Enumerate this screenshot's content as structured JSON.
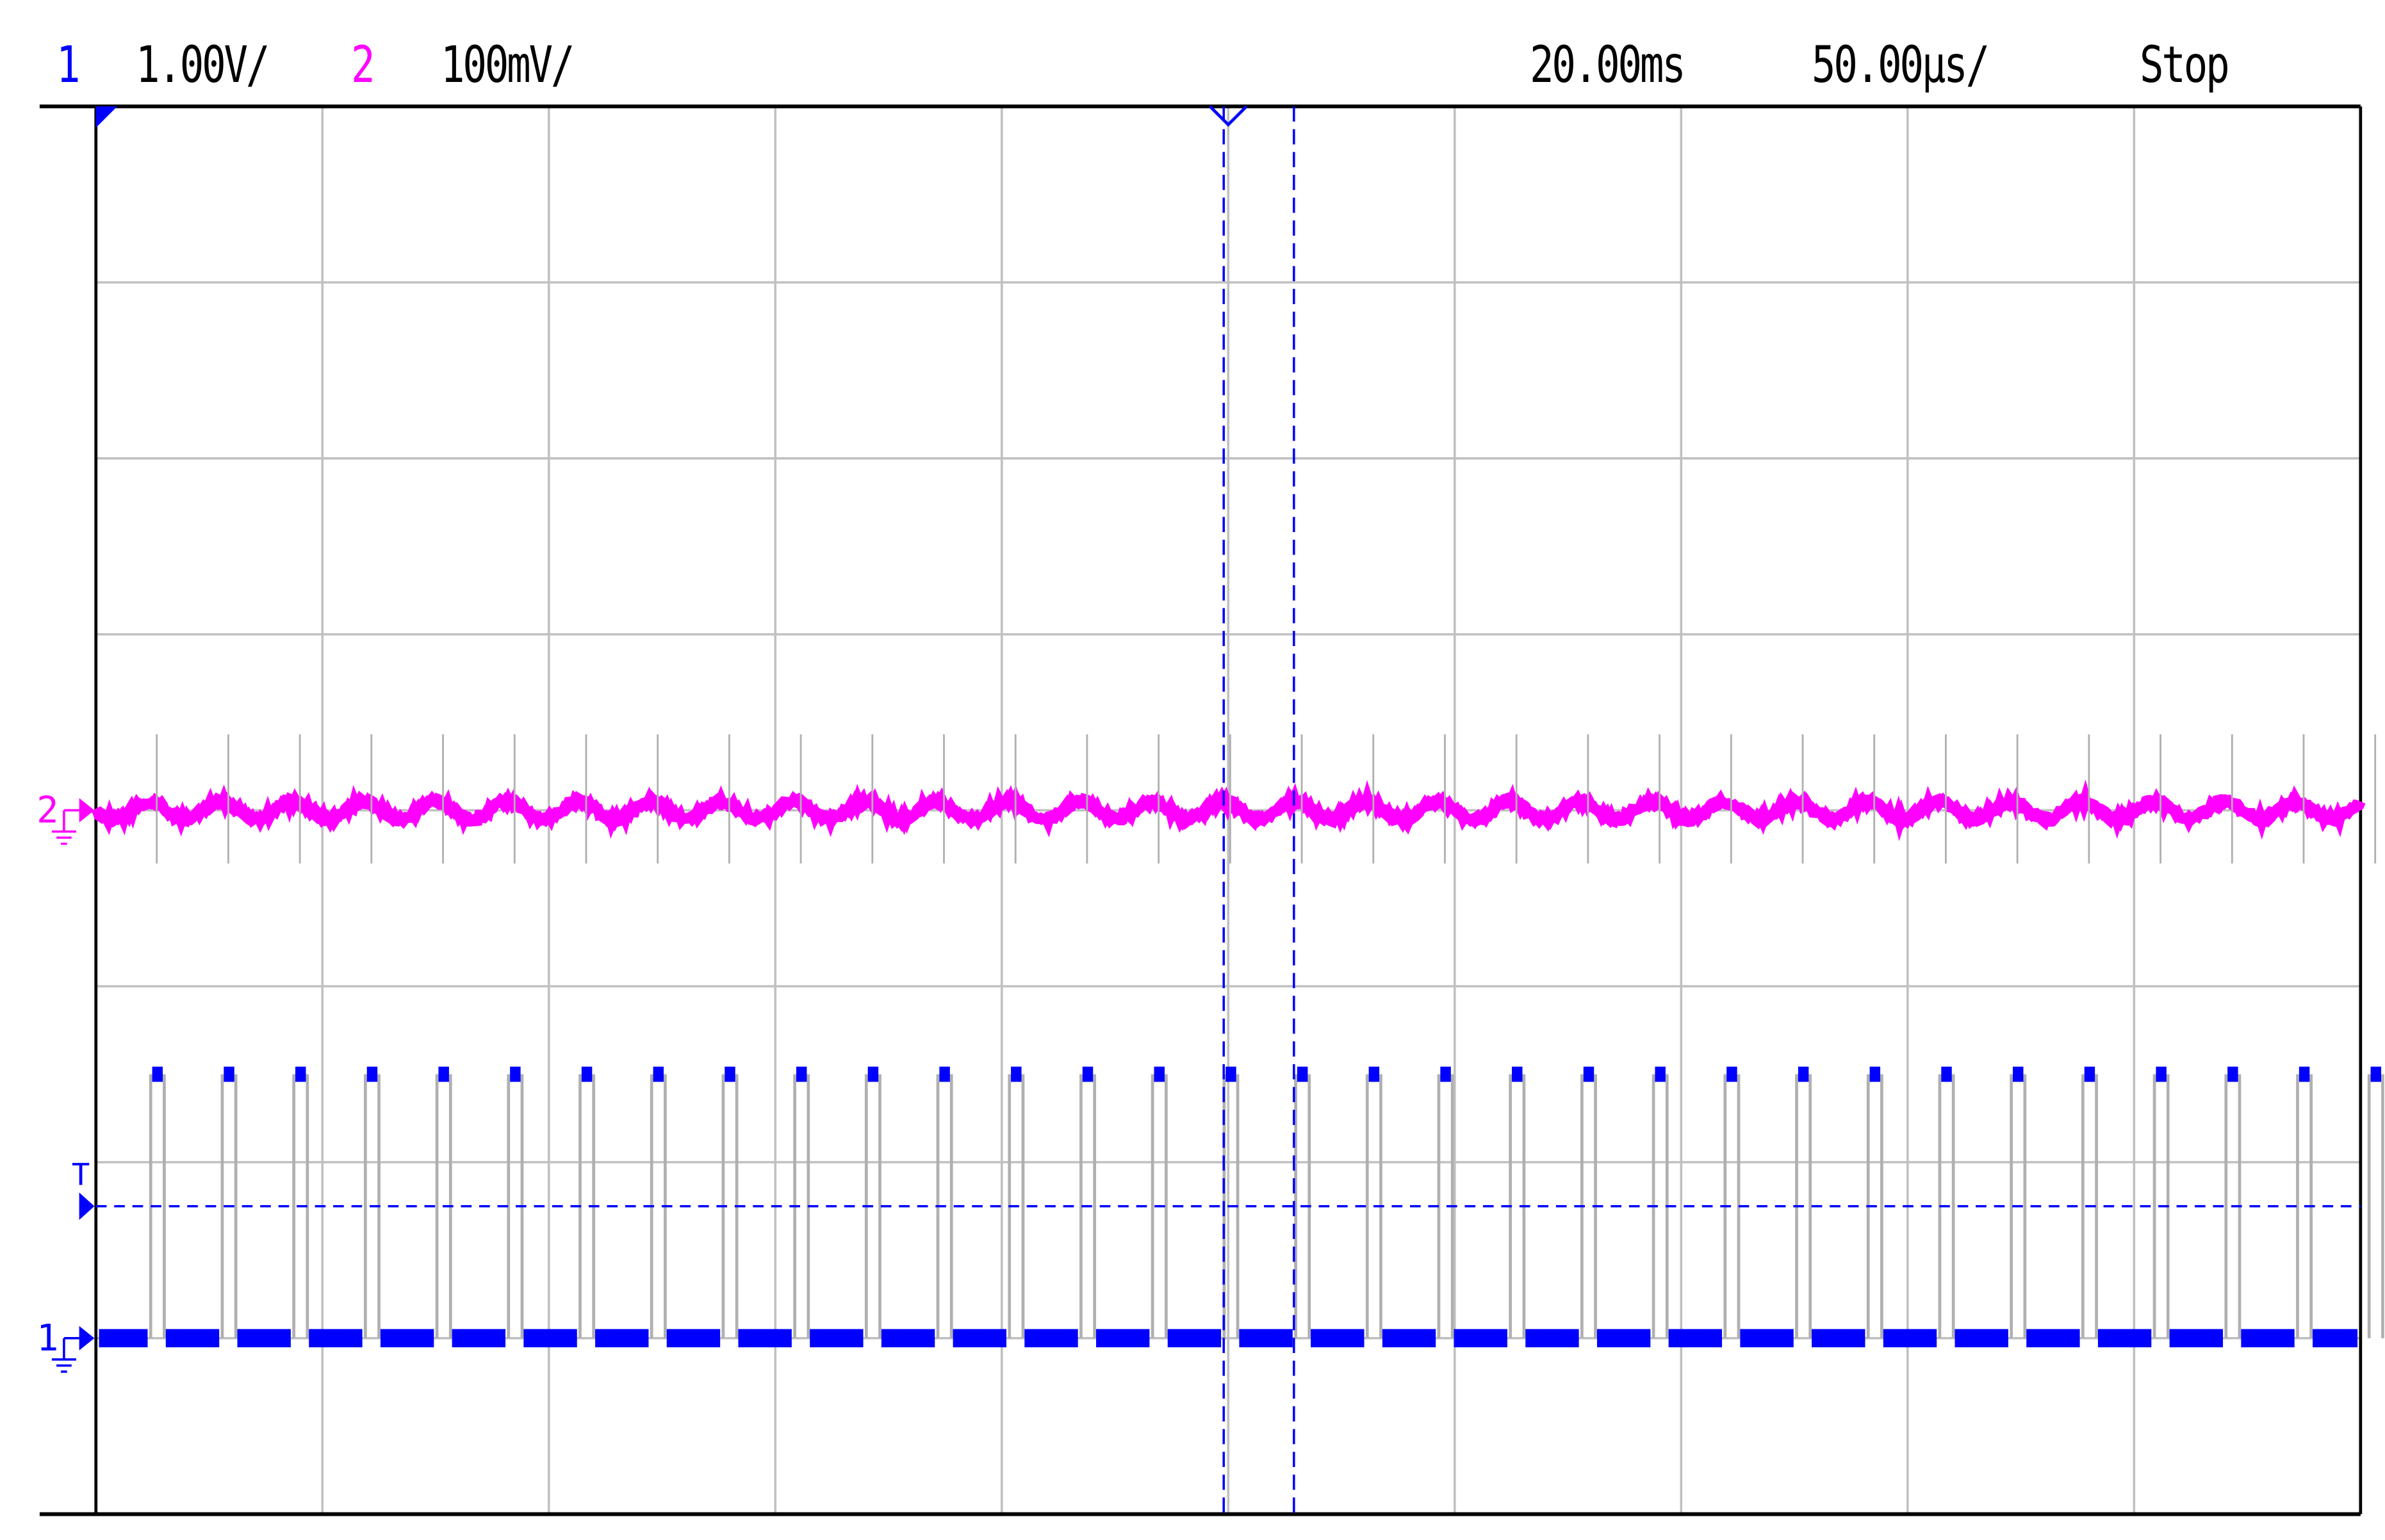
{
  "header": {
    "ch1_label": "1",
    "ch1_scale": "1.00V/",
    "ch2_label": "2",
    "ch2_scale": "100mV/",
    "trigger_time": "20.00ms",
    "timebase": "50.00µs/",
    "run_state": "Stop"
  },
  "colors": {
    "ch1": "#0000ff",
    "ch2": "#ff00ff",
    "grid": "#c0c0c0",
    "shadow": "#b0b0b0"
  },
  "chart_data": {
    "type": "line",
    "title": "",
    "grid": true,
    "x_divisions": 10,
    "y_divisions": 8,
    "x_unit_per_div": "50.00µs",
    "xlim_divs": [
      0,
      10
    ],
    "ylim_divs": [
      -4,
      4
    ],
    "series": [
      {
        "name": "1",
        "marker": "1",
        "volts_per_div": 1.0,
        "kind": "square",
        "offset_div": -3.0,
        "low_div": 0,
        "high_div": 1.5,
        "period_div": 0.316,
        "pulse_width_div": 0.06,
        "pulse_count": 32
      },
      {
        "name": "2",
        "marker": "2",
        "volts_per_div": 0.1,
        "kind": "ripple",
        "offset_div": 0.0,
        "ripple_pp_div": 0.2,
        "period_div": 0.316
      }
    ],
    "trigger_level_div": -2.25,
    "trigger_marker": "T",
    "cursors_x_div": [
      4.98,
      5.29
    ]
  }
}
